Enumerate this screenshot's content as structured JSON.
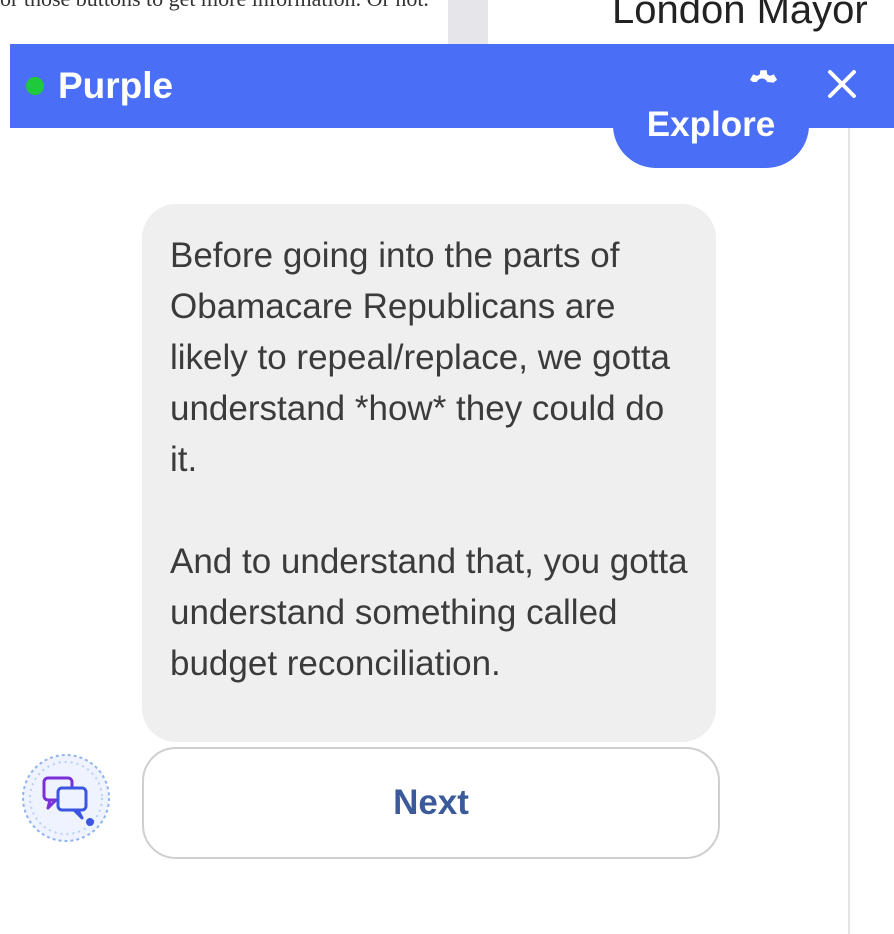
{
  "background": {
    "top_text": "or those buttons to get more information. Or not.",
    "right_text": "London Mayor"
  },
  "chat": {
    "title": "Purple",
    "status_color": "#1fc93a",
    "accent_color": "#4a6ef5",
    "header_icons": [
      "gear-icon",
      "close-icon"
    ],
    "messages": {
      "user": "Explore",
      "bot": [
        "Before going into the parts of Obamacare Republicans are likely to repeal/replace, we gotta understand *how* they could do it.",
        "And to understand that, you gotta understand something called budget reconciliation."
      ]
    },
    "reply_button": "Next",
    "avatar_icon": "chat-bubbles-icon"
  }
}
